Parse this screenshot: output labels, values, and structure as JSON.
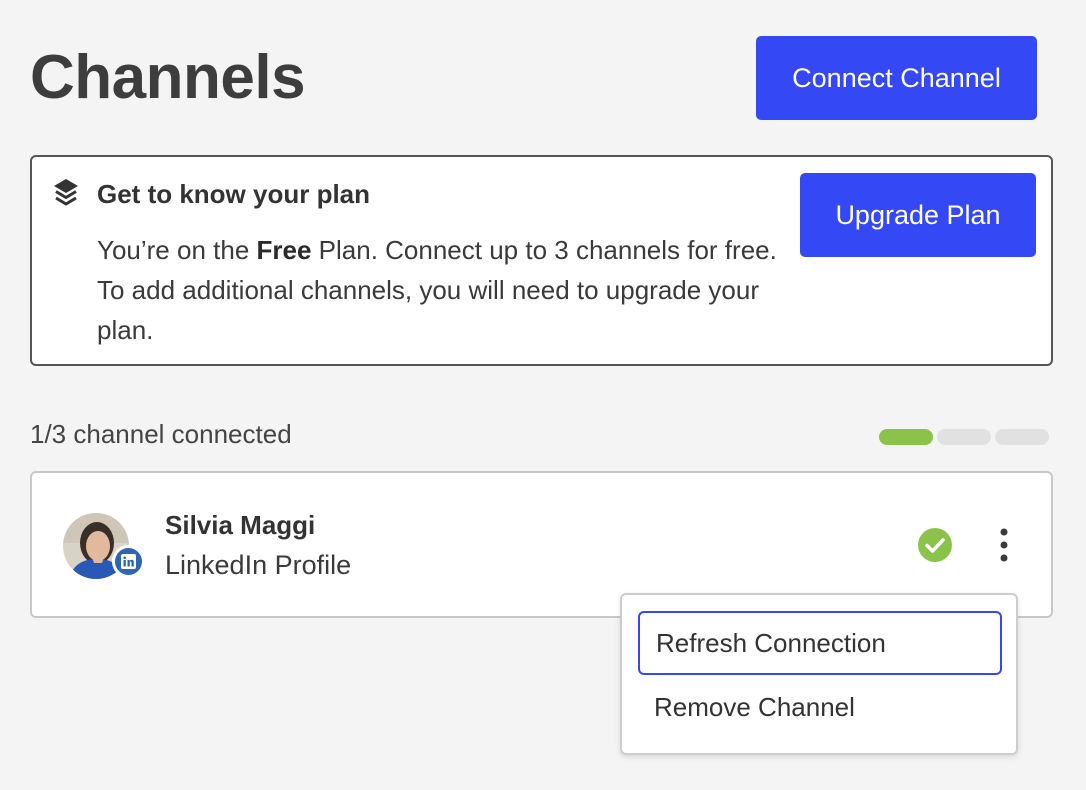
{
  "header": {
    "title": "Channels",
    "connect_label": "Connect Channel"
  },
  "plan": {
    "title": "Get to know your plan",
    "text_prefix": "You’re on the ",
    "plan_name": "Free",
    "text_suffix": " Plan. Connect up to 3 channels for free. To add additional channels, you will need to upgrade your plan.",
    "upgrade_label": "Upgrade Plan",
    "icon": "layers-icon"
  },
  "usage": {
    "label": "1/3 channel connected",
    "connected": 1,
    "limit": 3
  },
  "channel": {
    "name": "Silvia Maggi",
    "type": "LinkedIn Profile",
    "network_icon": "linkedin-icon",
    "status_icon": "check-circle-icon",
    "menu_icon": "kebab-menu-icon"
  },
  "menu": {
    "items": [
      {
        "label": "Refresh Connection",
        "focused": true
      },
      {
        "label": "Remove Channel",
        "focused": false
      }
    ]
  },
  "colors": {
    "accent": "#3449f5",
    "success": "#8bc34a",
    "linkedin": "#2f66b0"
  }
}
